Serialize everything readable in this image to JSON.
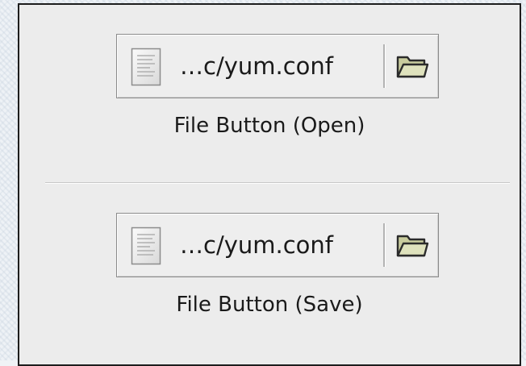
{
  "file_chooser_open": {
    "file_name": "…c/yum.conf",
    "caption": "File Button (Open)",
    "doc_icon": "text-document-icon",
    "folder_icon": "folder-icon"
  },
  "file_chooser_save": {
    "file_name": "…c/yum.conf",
    "caption": "File Button (Save)",
    "doc_icon": "text-document-icon",
    "folder_icon": "folder-icon"
  },
  "colors": {
    "panel_background": "#ececec",
    "frame_border": "#1d1d1d",
    "folder_fill": "#d9dcb4",
    "text": "#1a1a1a"
  }
}
